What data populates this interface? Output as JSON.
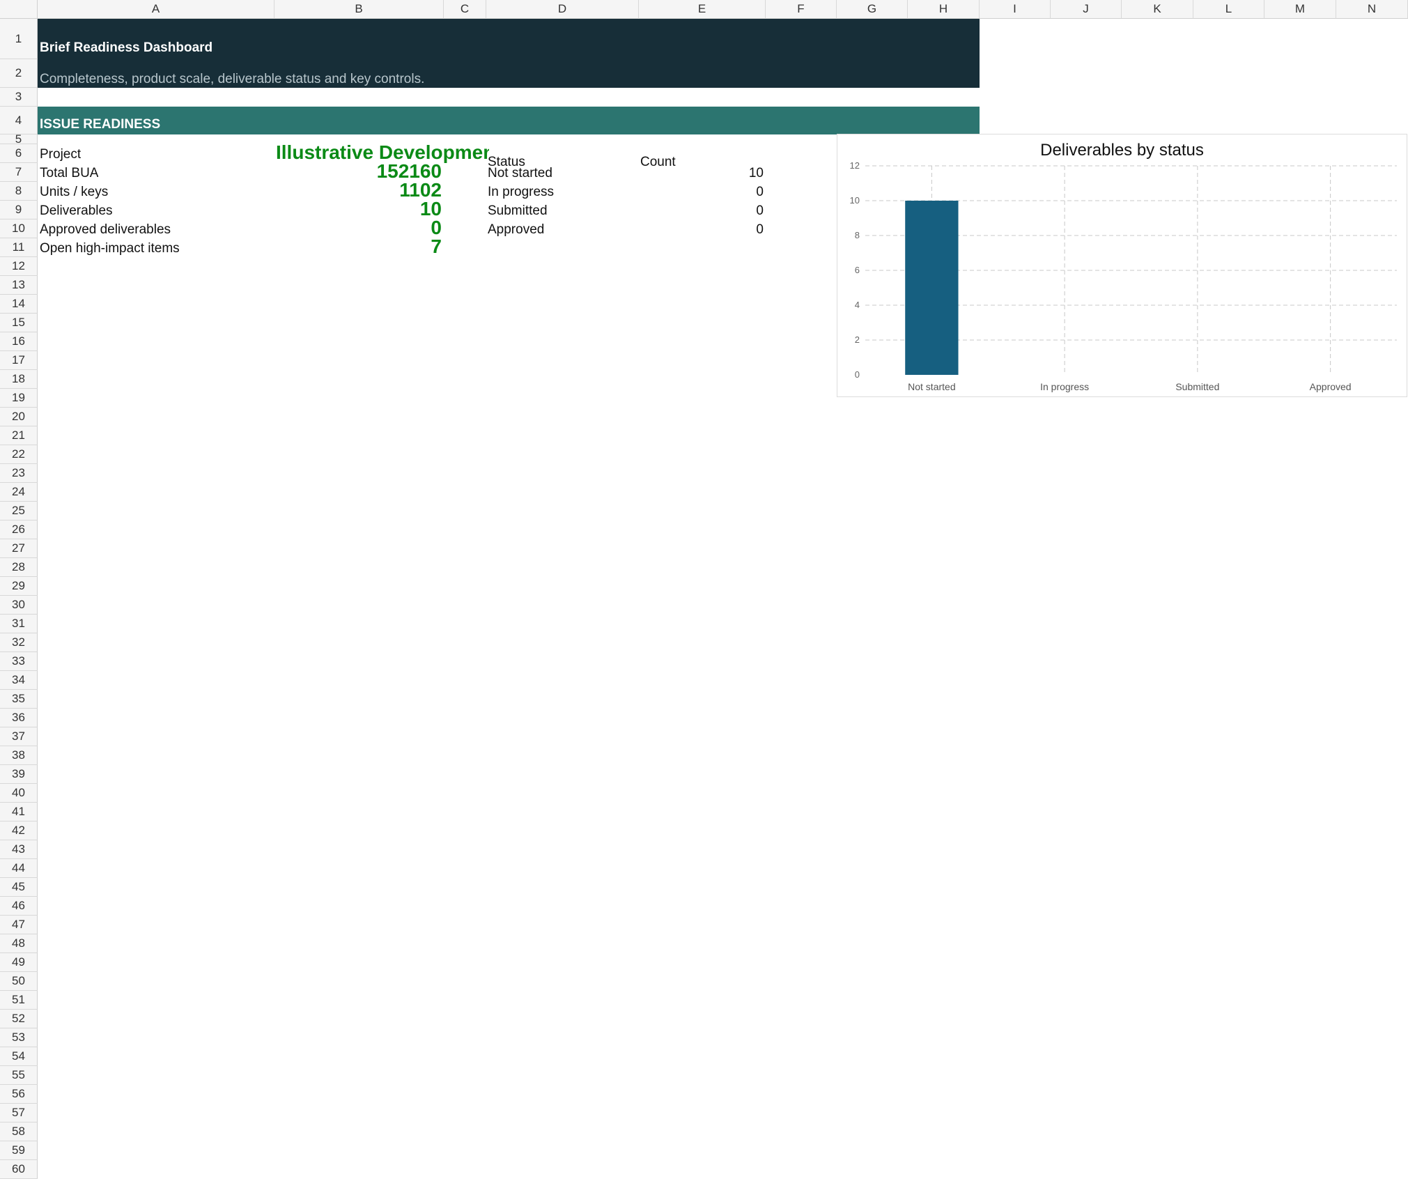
{
  "columns": [
    "A",
    "B",
    "C",
    "D",
    "E",
    "F",
    "G",
    "H",
    "I",
    "J",
    "K",
    "L",
    "M",
    "N"
  ],
  "rows_visible": 60,
  "title": "Brief Readiness Dashboard",
  "subtitle": "Completeness, product scale, deliverable status and key controls.",
  "section": "ISSUE READINESS",
  "kpis": [
    {
      "label": "Project",
      "value": "Illustrative Developmen"
    },
    {
      "label": "Total BUA",
      "value": "152160"
    },
    {
      "label": "Units / keys",
      "value": "1102"
    },
    {
      "label": "Deliverables",
      "value": "10"
    },
    {
      "label": "Approved deliverables",
      "value": "0"
    },
    {
      "label": "Open high-impact items",
      "value": "7"
    }
  ],
  "status_table": {
    "header_status": "Status",
    "header_count": "Count",
    "rows": [
      {
        "status": "Not started",
        "count": "10"
      },
      {
        "status": "In progress",
        "count": "0"
      },
      {
        "status": "Submitted",
        "count": "0"
      },
      {
        "status": "Approved",
        "count": "0"
      }
    ]
  },
  "colors": {
    "title_band": "#172e38",
    "section_band": "#2c7570",
    "kpi_green": "#0b8a16",
    "bar": "#165f80",
    "subtitle_text": "#b8c6cc"
  },
  "chart_data": {
    "type": "bar",
    "title": "Deliverables by status",
    "categories": [
      "Not started",
      "In progress",
      "Submitted",
      "Approved"
    ],
    "values": [
      10,
      0,
      0,
      0
    ],
    "ylim": [
      0,
      12
    ],
    "yticks": [
      0,
      2,
      4,
      6,
      8,
      10,
      12
    ],
    "grid": true
  }
}
